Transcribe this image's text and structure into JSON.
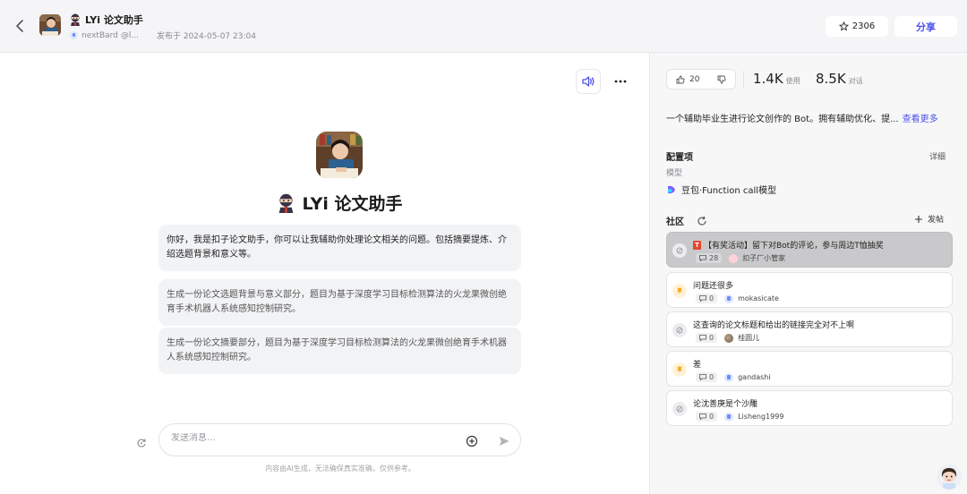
{
  "header": {
    "bot_name": "LYi 论文助手",
    "creator": "nextBard",
    "handle": "@l...",
    "published": "发布于 2024-05-07 23:04",
    "star_count": "2306",
    "share_label": "分享"
  },
  "chat": {
    "bot_title": "LYi 论文助手",
    "greeting": "你好，我是扣子论文助手，你可以让我辅助你处理论文相关的问题。包括摘要提炼、介绍选题背景和意义等。",
    "suggestions": [
      "生成一份论文选题背景与意义部分，题目为基于深度学习目标检测算法的火龙果微创绝育手术机器人系统感知控制研究。",
      "生成一份论文摘要部分，题目为基于深度学习目标检测算法的火龙果微创绝育手术机器人系统感知控制研究。"
    ],
    "input_placeholder": "发送消息...",
    "disclaimer": "内容由AI生成，无法确保真实准确，仅供参考。"
  },
  "sidebar": {
    "likes": "20",
    "uses": "1.4K",
    "uses_label": "使用",
    "chats": "8.5K",
    "chats_label": "对话",
    "description": "一个辅助毕业生进行论文创作的 Bot。拥有辅助优化、提...",
    "more_label": "查看更多",
    "config_title": "配置项",
    "detail_label": "详细",
    "model_label": "模型",
    "model_name": "豆包·Function call模型",
    "community_title": "社区",
    "post_label": "发帖",
    "posts": [
      {
        "tag": "T",
        "title": "【有奖活动】留下对Bot的评论，参与周边T恤抽奖",
        "count": "28",
        "user": "扣子厂小管家"
      },
      {
        "title": "问题还很多",
        "count": "0",
        "user": "mokasicate"
      },
      {
        "title": "这查询的论文标题和给出的链接完全对不上啊",
        "count": "0",
        "user": "桂圆儿"
      },
      {
        "title": "差",
        "count": "0",
        "user": "gandashi"
      },
      {
        "title": "论沈善庚是个沙雕",
        "count": "0",
        "user": "Lisheng1999"
      }
    ]
  },
  "colors": {
    "accent": "#4d53e8",
    "active_card": "#c9c9cb"
  }
}
